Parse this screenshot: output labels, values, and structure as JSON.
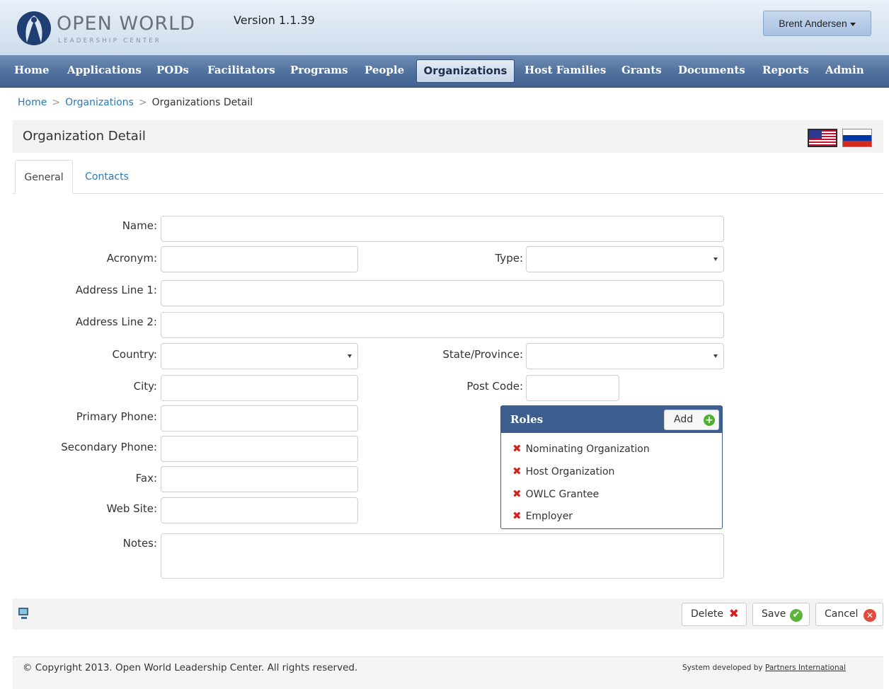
{
  "header": {
    "logo_text": "OPEN WORLD",
    "logo_sub": "LEADERSHIP CENTER",
    "version": "Version 1.1.39",
    "user_name": "Brent Andersen"
  },
  "nav": {
    "items": [
      "Home",
      "Applications",
      "PODs",
      "Facilitators",
      "Programs",
      "People",
      "Organizations",
      "Host Families",
      "Grants",
      "Documents",
      "Reports",
      "Admin"
    ],
    "active": "Organizations"
  },
  "breadcrumb": {
    "home": "Home",
    "organizations": "Organizations",
    "current": "Organizations Detail",
    "separator": ">"
  },
  "page": {
    "title": "Organization Detail",
    "flags": [
      "us-flag-icon",
      "ru-flag-icon"
    ]
  },
  "tabs": {
    "general": "General",
    "contacts": "Contacts"
  },
  "form": {
    "name_label": "Name:",
    "acronym_label": "Acronym:",
    "type_label": "Type:",
    "address1_label": "Address Line 1:",
    "address2_label": "Address Line 2:",
    "country_label": "Country:",
    "state_label": "State/Province:",
    "city_label": "City:",
    "postcode_label": "Post Code:",
    "primary_phone_label": "Primary Phone:",
    "secondary_phone_label": "Secondary Phone:",
    "fax_label": "Fax:",
    "website_label": "Web Site:",
    "notes_label": "Notes:",
    "values": {
      "name": "",
      "acronym": "",
      "type": "",
      "address1": "",
      "address2": "",
      "country": "",
      "state": "",
      "city": "",
      "postcode": "",
      "primary_phone": "",
      "secondary_phone": "",
      "fax": "",
      "website": "",
      "notes": ""
    }
  },
  "roles": {
    "title": "Roles",
    "add_label": "Add",
    "items": [
      "Nominating Organization",
      "Host Organization",
      "OWLC Grantee",
      "Employer"
    ]
  },
  "actions": {
    "delete": "Delete",
    "save": "Save",
    "cancel": "Cancel"
  },
  "footer": {
    "copyright": "© Copyright 2013. Open World Leadership Center. All rights reserved.",
    "dev_prefix": "System developed by",
    "dev_link": "Partners International"
  },
  "colors": {
    "nav_bg": "#4e6e9b",
    "link": "#2a7ab8",
    "roles_header": "#3c5f8f",
    "delete_icon": "#d62020",
    "save_icon": "#5ab33a"
  }
}
